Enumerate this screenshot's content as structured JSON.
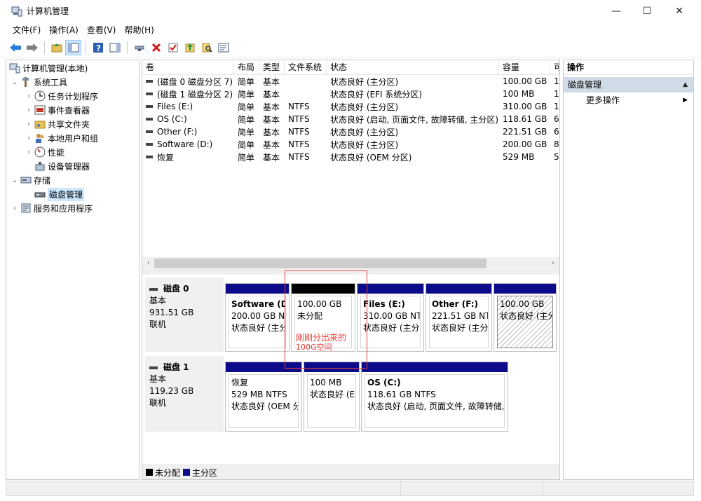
{
  "window": {
    "title": "计算机管理",
    "min_glyph": "—",
    "max_glyph": "☐",
    "close_glyph": "✕"
  },
  "menu": [
    "文件(F)",
    "操作(A)",
    "查看(V)",
    "帮助(H)"
  ],
  "tree": {
    "root": "计算机管理(本地)",
    "system_tools": "系统工具",
    "task_scheduler": "任务计划程序",
    "event_viewer": "事件查看器",
    "shared_folders": "共享文件夹",
    "local_users": "本地用户和组",
    "performance": "性能",
    "device_manager": "设备管理器",
    "storage": "存储",
    "disk_management": "磁盘管理",
    "services_apps": "服务和应用程序"
  },
  "volume_list": {
    "headers": [
      "卷",
      "布局",
      "类型",
      "文件系统",
      "状态",
      "容量",
      "可"
    ],
    "rows": [
      [
        "(磁盘 0 磁盘分区 7)",
        "简单",
        "基本",
        "",
        "状态良好 (主分区)",
        "100.00 GB",
        "1"
      ],
      [
        "(磁盘 1 磁盘分区 2)",
        "简单",
        "基本",
        "",
        "状态良好 (EFI 系统分区)",
        "100 MB",
        "1"
      ],
      [
        "Files (E:)",
        "简单",
        "基本",
        "NTFS",
        "状态良好 (主分区)",
        "310.00 GB",
        "1"
      ],
      [
        "OS (C:)",
        "简单",
        "基本",
        "NTFS",
        "状态良好 (启动, 页面文件, 故障转储, 主分区)",
        "118.61 GB",
        "6"
      ],
      [
        "Other (F:)",
        "简单",
        "基本",
        "NTFS",
        "状态良好 (主分区)",
        "221.51 GB",
        "6"
      ],
      [
        "Software (D:)",
        "简单",
        "基本",
        "NTFS",
        "状态良好 (主分区)",
        "200.00 GB",
        "8"
      ],
      [
        "恢复",
        "简单",
        "基本",
        "NTFS",
        "状态良好 (OEM 分区)",
        "529 MB",
        "5"
      ]
    ]
  },
  "scroll_arrows": {
    "left": "‹",
    "right": "›"
  },
  "disk0": {
    "name": "磁盘 0",
    "type": "基本",
    "size": "931.51 GB",
    "state": "联机",
    "parts": [
      {
        "name": "Software  (D:",
        "size": "200.00 GB NT",
        "status": "状态良好 (主分"
      },
      {
        "name": "",
        "size": "100.00 GB",
        "status": "未分配"
      },
      {
        "name": "Files  (E:)",
        "size": "310.00 GB NTF",
        "status": "状态良好 (主分["
      },
      {
        "name": "Other  (F:)",
        "size": "221.51 GB NT",
        "status": "状态良好 (主分"
      },
      {
        "name": "",
        "size": "100.00 GB",
        "status": "状态良好 (主分"
      }
    ]
  },
  "disk1": {
    "name": "磁盘 1",
    "type": "基本",
    "size": "119.23 GB",
    "state": "联机",
    "parts": [
      {
        "name": "恢复",
        "size": "529 MB NTFS",
        "status": "状态良好 (OEM 分"
      },
      {
        "name": "",
        "size": "100 MB",
        "status": "状态良好 (EF"
      },
      {
        "name": "OS  (C:)",
        "size": "118.61 GB NTFS",
        "status": "状态良好 (启动, 页面文件, 故障转储,"
      }
    ]
  },
  "annotation": {
    "line1": "刚刚分出来的",
    "line2": "100G空间",
    "color": "#e53935"
  },
  "legend": {
    "unallocated": "未分配",
    "primary": "主分区",
    "unallocated_color": "#000000",
    "primary_color": "#0c0c8a"
  },
  "actions": {
    "header": "操作",
    "section": "磁盘管理",
    "more": "更多操作",
    "section_caret": "▲",
    "more_caret": "▶"
  },
  "colors": {
    "selection": "#cce8ff",
    "action_section": "#cfdce8"
  }
}
